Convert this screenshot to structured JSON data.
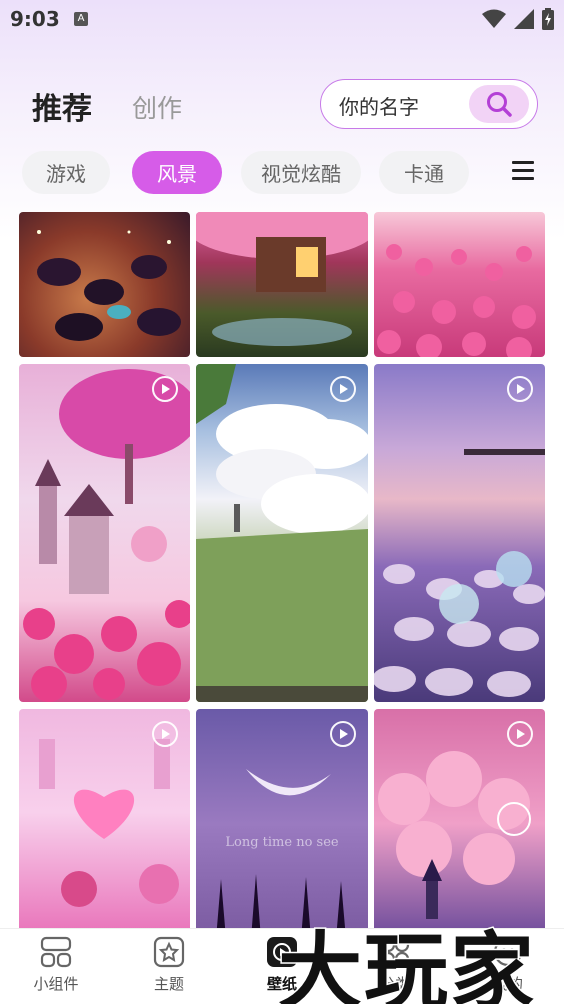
{
  "status_bar": {
    "time": "9:03",
    "app_badge": "A"
  },
  "header": {
    "tabs": [
      {
        "label": "推荐",
        "active": true
      },
      {
        "label": "创作",
        "active": false
      }
    ],
    "search": {
      "value": "你的名字"
    }
  },
  "categories": {
    "items": [
      "游戏",
      "风景",
      "视觉炫酷",
      "卡通"
    ],
    "selected": "风景"
  },
  "grid": {
    "tiles": [
      {
        "caption": "",
        "is_video": false
      },
      {
        "caption": "",
        "is_video": false
      },
      {
        "caption": "",
        "is_video": false
      },
      {
        "caption": "",
        "is_video": true
      },
      {
        "caption": "",
        "is_video": true
      },
      {
        "caption": "",
        "is_video": true
      },
      {
        "caption": "",
        "is_video": true
      },
      {
        "caption": "Long time no see",
        "is_video": true
      },
      {
        "caption": "",
        "is_video": true
      }
    ]
  },
  "bottom_nav": {
    "items": [
      {
        "label": "小组件",
        "icon": "widgets-icon"
      },
      {
        "label": "主题",
        "icon": "theme-icon"
      },
      {
        "label": "壁纸",
        "icon": "wallpaper-play-icon",
        "active": true
      },
      {
        "label": "分类",
        "icon": "category-icon"
      },
      {
        "label": "我的",
        "icon": "profile-icon"
      }
    ]
  },
  "watermark": {
    "text": "大玩家"
  },
  "colors": {
    "accent": "#d65ce8",
    "search_border": "#c77ae8",
    "search_button": "#f2d3f6"
  }
}
